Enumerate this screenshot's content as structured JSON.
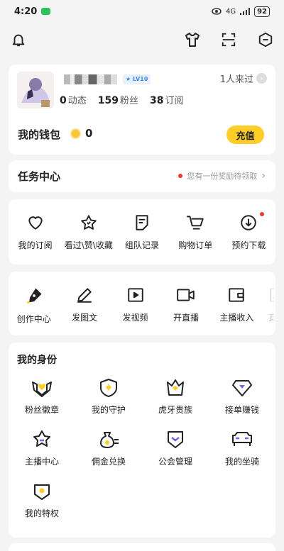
{
  "status": {
    "time": "4:20",
    "network": "4G",
    "battery": "92"
  },
  "profile": {
    "visitors": "1人来过",
    "level": "LV10",
    "stats": [
      {
        "value": "0",
        "label": "动态"
      },
      {
        "value": "159",
        "label": "粉丝"
      },
      {
        "value": "38",
        "label": "订阅"
      }
    ]
  },
  "wallet": {
    "label": "我的钱包",
    "coins": "0",
    "recharge": "充值"
  },
  "task": {
    "title": "任务中心",
    "hint": "您有一份奖励待领取"
  },
  "quick": [
    {
      "label": "我的订阅",
      "icon": "heart-icon"
    },
    {
      "label": "看过\\赞\\收藏",
      "icon": "star-icon"
    },
    {
      "label": "组队记录",
      "icon": "note-icon"
    },
    {
      "label": "购物订单",
      "icon": "cart-icon"
    },
    {
      "label": "预约下载",
      "icon": "download-icon"
    }
  ],
  "creator": [
    {
      "label": "创作中心",
      "icon": "pen-nib-icon"
    },
    {
      "label": "发图文",
      "icon": "pencil-icon"
    },
    {
      "label": "发视频",
      "icon": "video-play-icon"
    },
    {
      "label": "开直播",
      "icon": "camera-icon"
    },
    {
      "label": "主播收入",
      "icon": "wallet-icon"
    },
    {
      "label": "直播",
      "icon": "image-icon"
    }
  ],
  "identity": {
    "title": "我的身份",
    "items": [
      {
        "label": "粉丝徽章",
        "icon": "fan-badge-icon"
      },
      {
        "label": "我的守护",
        "icon": "guard-shield-icon"
      },
      {
        "label": "虎牙贵族",
        "icon": "noble-crown-icon"
      },
      {
        "label": "接单赚钱",
        "icon": "gem-icon"
      },
      {
        "label": "主播中心",
        "icon": "anchor-star-icon"
      },
      {
        "label": "佣金兑换",
        "icon": "money-bag-icon"
      },
      {
        "label": "公会管理",
        "icon": "guild-shield-icon"
      },
      {
        "label": "我的坐骑",
        "icon": "car-icon"
      },
      {
        "label": "我的特权",
        "icon": "privilege-icon"
      }
    ]
  },
  "colors": {
    "accent": "#ffcd28",
    "purple": "#7b63e6",
    "red": "#e53935",
    "blue": "#3a8bf0"
  }
}
